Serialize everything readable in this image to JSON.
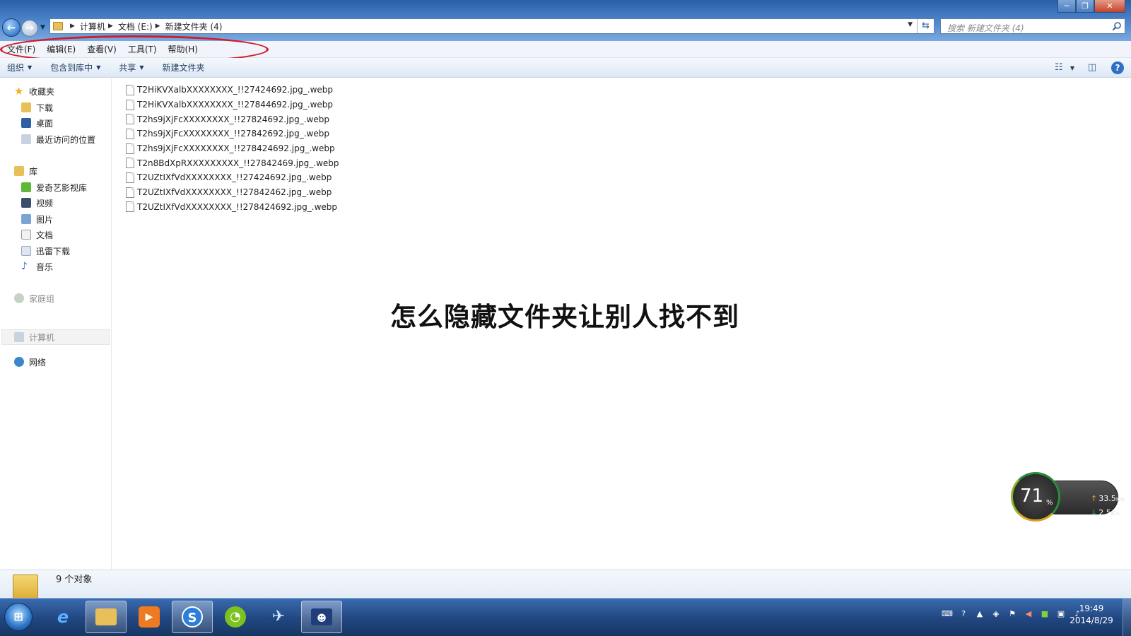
{
  "window": {
    "buttons": {
      "minimize": "─",
      "maximize": "❐",
      "close": "✕"
    }
  },
  "address": {
    "crumbs": [
      "计算机",
      "文档 (E:)",
      "新建文件夹 (4)"
    ]
  },
  "search": {
    "placeholder": "搜索 新建文件夹 (4)"
  },
  "menubar": {
    "items": [
      "文件(F)",
      "编辑(E)",
      "查看(V)",
      "工具(T)",
      "帮助(H)"
    ],
    "highlight_color": "#d11d2a"
  },
  "commandbar": {
    "items": [
      "组织",
      "包含到库中",
      "共享",
      "新建文件夹"
    ]
  },
  "navpane": {
    "favorites": {
      "label": "收藏夹",
      "items": [
        "下载",
        "桌面",
        "最近访问的位置"
      ]
    },
    "libraries": {
      "label": "库",
      "items": [
        "爱奇艺影视库",
        "视频",
        "图片",
        "文档",
        "迅雷下载",
        "音乐"
      ]
    },
    "homegroup": "家庭组",
    "computer": "计算机",
    "network": "网络"
  },
  "files": [
    "T2HiKVXalbXXXXXXXX_!!27424692.jpg_.webp",
    "T2HiKVXalbXXXXXXXX_!!27844692.jpg_.webp",
    "T2hs9jXjFcXXXXXXXX_!!27824692.jpg_.webp",
    "T2hs9jXjFcXXXXXXXX_!!27842692.jpg_.webp",
    "T2hs9jXjFcXXXXXXXX_!!278424692.jpg_.webp",
    "T2n8BdXpRXXXXXXXXX_!!27842469.jpg_.webp",
    "T2UZtIXfVdXXXXXXXX_!!27424692.jpg_.webp",
    "T2UZtIXfVdXXXXXXXX_!!27842462.jpg_.webp",
    "T2UZtIXfVdXXXXXXXX_!!278424692.jpg_.webp"
  ],
  "overlay_title": "怎么隐藏文件夹让别人找不到",
  "details": {
    "count": "9 个对象"
  },
  "network_widget": {
    "percent": "71",
    "percent_sign": "%",
    "upload": "33.5",
    "download": "2.5",
    "unit": "K/s"
  },
  "taskbar": {
    "start_icon": "windows-logo-icon",
    "apps": [
      "internet-explorer-icon",
      "file-explorer-icon",
      "media-player-icon",
      "sogou-icon",
      "green-app-icon",
      "feiq-icon",
      "display-app-icon"
    ],
    "clock": {
      "time": "19:49",
      "date": "2014/8/29"
    }
  }
}
